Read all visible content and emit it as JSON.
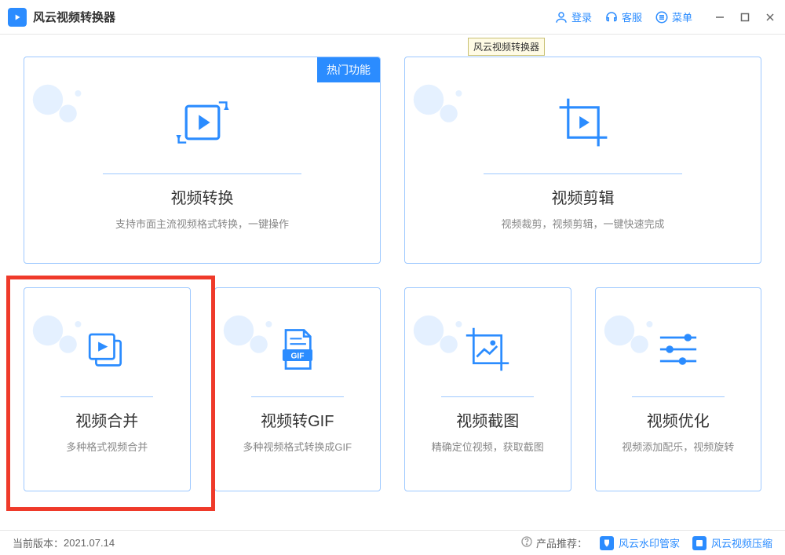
{
  "colors": {
    "accent": "#2b8cff",
    "border": "#9ec9ff",
    "highlight": "#ef3a2a"
  },
  "titlebar": {
    "app_title": "风云视频转换器",
    "login_label": "登录",
    "support_label": "客服",
    "menu_label": "菜单"
  },
  "tooltip": {
    "text": "风云视频转换器"
  },
  "cards": {
    "convert": {
      "badge": "热门功能",
      "title": "视频转换",
      "desc": "支持市面主流视频格式转换，一键操作"
    },
    "edit": {
      "title": "视频剪辑",
      "desc": "视频裁剪，视频剪辑，一键快速完成"
    },
    "merge": {
      "title": "视频合并",
      "desc": "多种格式视频合并"
    },
    "gif": {
      "title": "视频转GIF",
      "gif_badge": "GIF",
      "desc": "多种视频格式转换成GIF"
    },
    "screenshot": {
      "title": "视频截图",
      "desc": "精确定位视频，获取截图"
    },
    "optimize": {
      "title": "视频优化",
      "desc": "视频添加配乐，视频旋转"
    }
  },
  "footer": {
    "version_label": "当前版本：",
    "version_value": "2021.07.14",
    "recommend_label": "产品推荐：",
    "rec1": "风云水印管家",
    "rec2": "风云视频压缩"
  }
}
